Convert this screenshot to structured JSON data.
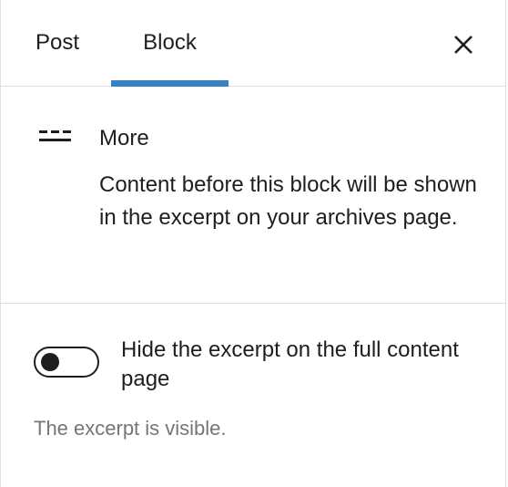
{
  "tabs": {
    "post_label": "Post",
    "block_label": "Block",
    "active": "Block"
  },
  "close": {
    "icon": "close-icon"
  },
  "block_card": {
    "icon": "more-block-icon",
    "title": "More",
    "description": "Content before this block will be shown in the excerpt on your archives page."
  },
  "settings": {
    "toggle_label": "Hide the excerpt on the full content page",
    "toggle_checked": false,
    "help_text": "The excerpt is visible."
  },
  "colors": {
    "accent": "#3582c4",
    "text": "#1e1e1e",
    "muted": "#757575",
    "border": "#e0e0e0"
  }
}
